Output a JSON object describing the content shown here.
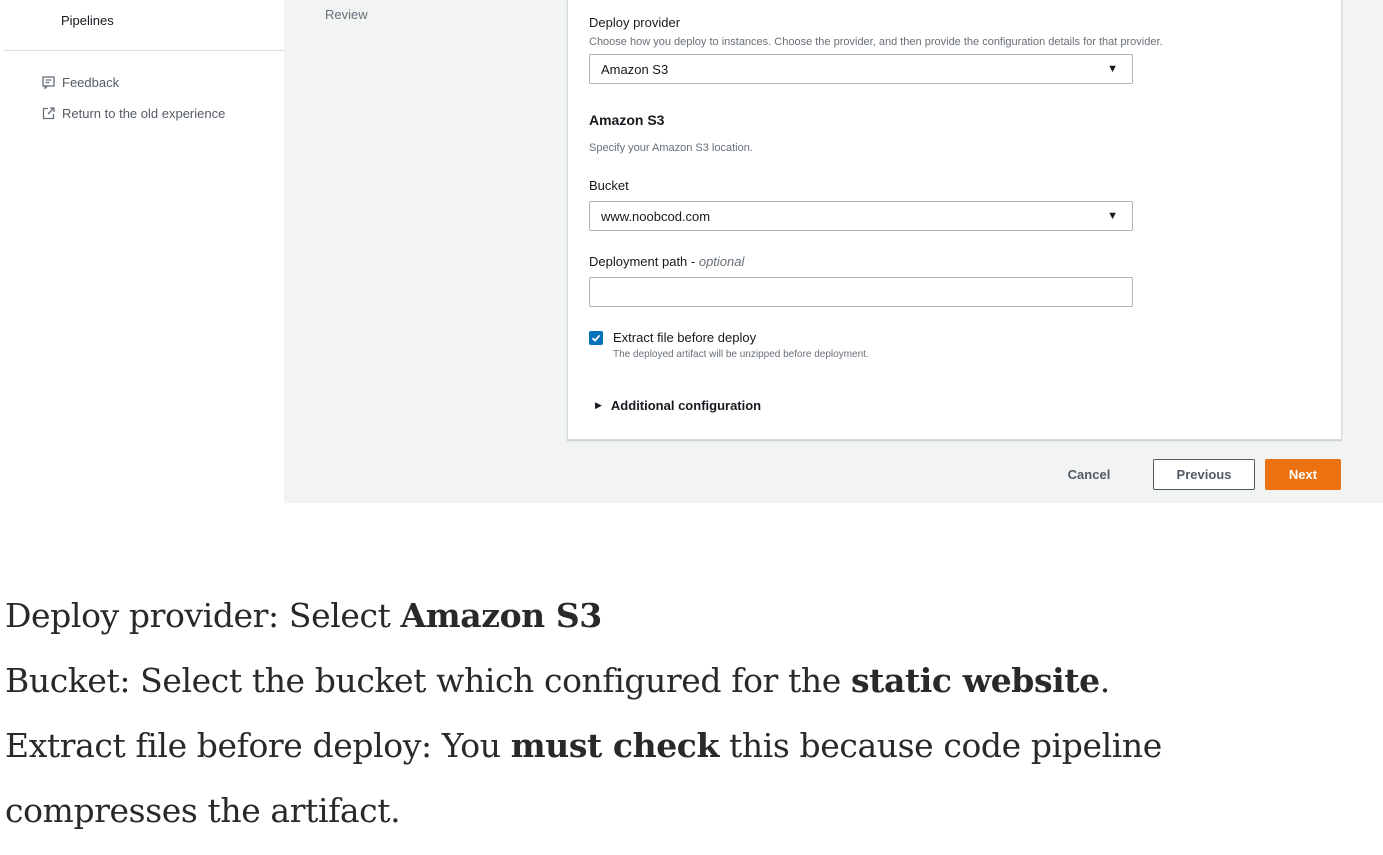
{
  "sidebar": {
    "pipelines_label": "Pipelines",
    "feedback_label": "Feedback",
    "feedback_icon": "feedback-icon",
    "return_label": "Return to the old experience",
    "return_icon": "external-link-icon"
  },
  "steps": {
    "review_label": "Review"
  },
  "form": {
    "deploy_provider": {
      "label": "Deploy provider",
      "description": "Choose how you deploy to instances. Choose the provider, and then provide the configuration details for that provider.",
      "value": "Amazon S3"
    },
    "s3_section": {
      "title": "Amazon S3",
      "description": "Specify your Amazon S3 location."
    },
    "bucket": {
      "label": "Bucket",
      "value": "www.noobcod.com"
    },
    "deployment_path": {
      "label": "Deployment path - ",
      "label_optional": "optional",
      "value": ""
    },
    "extract": {
      "label": "Extract file before deploy",
      "description": "The deployed artifact will be unzipped before deployment.",
      "checked": true
    },
    "additional_config_label": "Additional configuration"
  },
  "footer": {
    "cancel_label": "Cancel",
    "previous_label": "Previous",
    "next_label": "Next"
  },
  "colors": {
    "accent_orange": "#ec7211",
    "checkbox_blue": "#0073bb",
    "page_gray": "#f2f3f3"
  },
  "article": {
    "line1_pre": "Deploy provider: Select ",
    "line1_bold": "Amazon S3",
    "line2_pre": "Bucket: Select the bucket which configured for the ",
    "line2_bold": "static website",
    "line2_post": ".",
    "line3_pre": "Extract file before deploy: You ",
    "line3_bold": "must check",
    "line3_post": " this because code pipeline",
    "line4": "compresses the artifact."
  }
}
